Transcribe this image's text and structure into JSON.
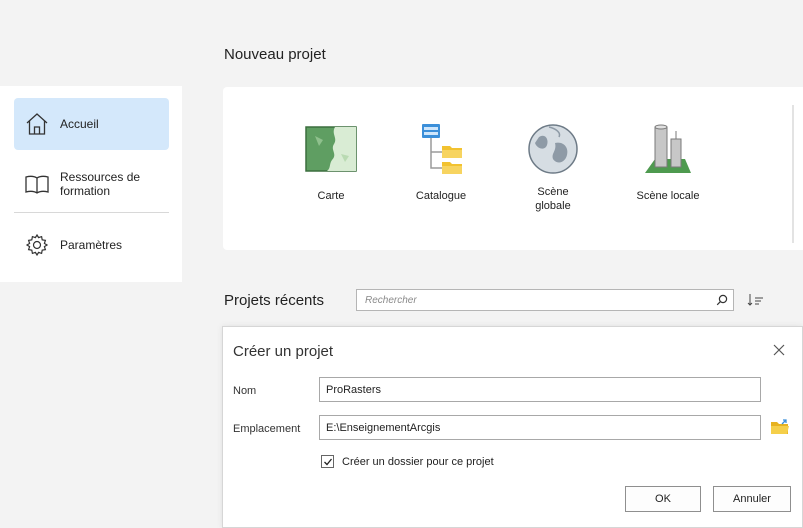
{
  "sidebar": {
    "items": [
      {
        "label": "Accueil",
        "icon": "home-icon",
        "active": true
      },
      {
        "label": "Ressources de formation",
        "icon": "book-icon",
        "active": false
      },
      {
        "label": "Paramètres",
        "icon": "gear-icon",
        "active": false
      }
    ]
  },
  "new_project": {
    "heading": "Nouveau projet",
    "templates": [
      {
        "label": "Carte",
        "icon": "map-icon"
      },
      {
        "label": "Catalogue",
        "icon": "catalog-icon"
      },
      {
        "label": "Scène globale",
        "icon": "globe-icon"
      },
      {
        "label": "Scène locale",
        "icon": "local-scene-icon"
      }
    ]
  },
  "recent": {
    "heading": "Projets récents",
    "search_placeholder": "Rechercher",
    "search_icon": "search-icon",
    "sort_icon": "sort-icon"
  },
  "dialog": {
    "title": "Créer un projet",
    "name_label": "Nom",
    "name_value": "ProRasters",
    "location_label": "Emplacement",
    "location_value": "E:\\EnseignementArcgis",
    "checkbox_label": "Créer un dossier pour ce projet",
    "checkbox_checked": true,
    "ok_label": "OK",
    "cancel_label": "Annuler"
  },
  "colors": {
    "accent_selected": "#d4e8fb",
    "background": "#f3f3f3",
    "folder_yellow": "#f2c230"
  }
}
